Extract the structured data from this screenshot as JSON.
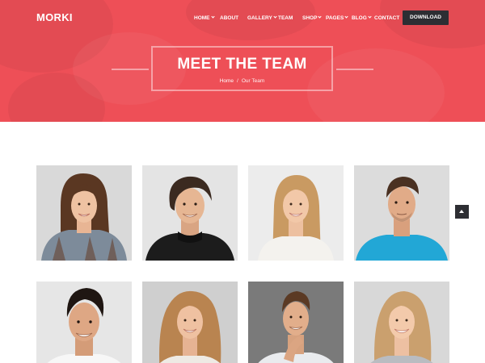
{
  "brand": {
    "logo": "MORKI"
  },
  "nav": {
    "items": [
      {
        "label": "HOME",
        "dropdown": true
      },
      {
        "label": "ABOUT",
        "dropdown": false
      },
      {
        "label": "GALLERY",
        "dropdown": true
      },
      {
        "label": "TEAM",
        "dropdown": false
      },
      {
        "label": "SHOP",
        "dropdown": true
      },
      {
        "label": "PAGES",
        "dropdown": true
      },
      {
        "label": "BLOG",
        "dropdown": true
      },
      {
        "label": "CONTACT",
        "dropdown": false
      }
    ],
    "download_label": "DOWNLOAD"
  },
  "hero": {
    "title": "MEET THE TEAM",
    "breadcrumb": {
      "home": "Home",
      "separator": "/",
      "current": "Our Team"
    }
  },
  "colors": {
    "accent": "#ee4f57",
    "dark": "#2d2e33",
    "white": "#ffffff"
  },
  "team": [
    {
      "photo": "woman-long-brown-hair-plaid-shirt"
    },
    {
      "photo": "man-curly-hair-black-turtleneck"
    },
    {
      "photo": "woman-blonde-white-top"
    },
    {
      "photo": "man-blue-tshirt"
    },
    {
      "photo": "man-dark-hair-white-shirt"
    },
    {
      "photo": "woman-curly-blonde-hair"
    },
    {
      "photo": "man-hand-on-chin"
    },
    {
      "photo": "woman-blonde-grey-top"
    }
  ],
  "icons": {
    "scroll_top": "chevron-up-icon"
  }
}
